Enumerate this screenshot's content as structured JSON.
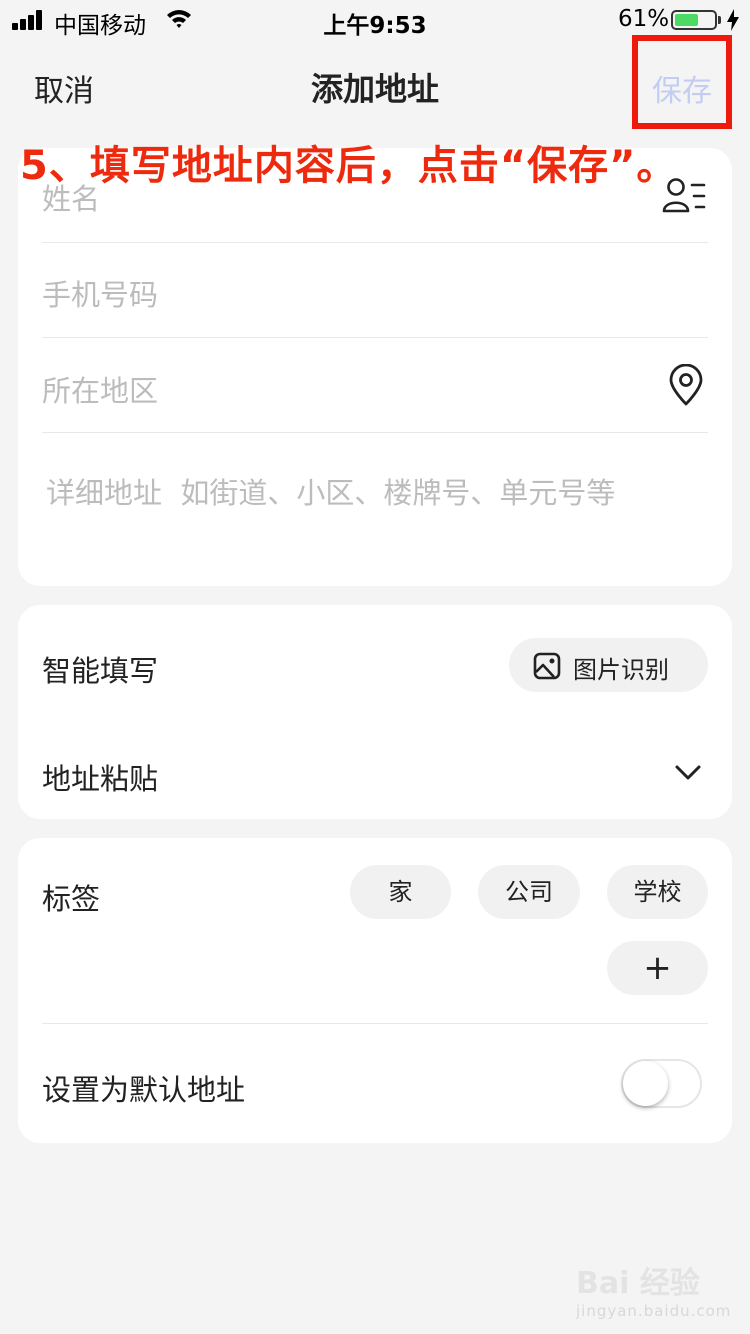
{
  "status_bar": {
    "carrier": "中国移动",
    "time": "上午9:53",
    "battery_percent": "61%",
    "battery_level": 0.61
  },
  "nav": {
    "cancel": "取消",
    "title": "添加地址",
    "save": "保存"
  },
  "annotation": "5、填写地址内容后，点击“保存”。",
  "form": {
    "name_placeholder": "姓名",
    "phone_placeholder": "手机号码",
    "region_placeholder": "所在地区",
    "detail_placeholder": "详细地址  如街道、小区、楼牌号、单元号等"
  },
  "smart_fill": {
    "label": "智能填写",
    "image_recognition_button": "图片识别",
    "paste_label": "地址粘贴"
  },
  "tags": {
    "label": "标签",
    "options": [
      "家",
      "公司",
      "学校"
    ],
    "add": "+"
  },
  "default_address": {
    "label": "设置为默认地址",
    "enabled": false
  },
  "watermark": {
    "brand": "Bai 经验",
    "url": "jingyan.baidu.com"
  },
  "colors": {
    "annotation": "#ee2a0e",
    "save_disabled": "#c3cdf2",
    "battery": "#4cd964"
  }
}
